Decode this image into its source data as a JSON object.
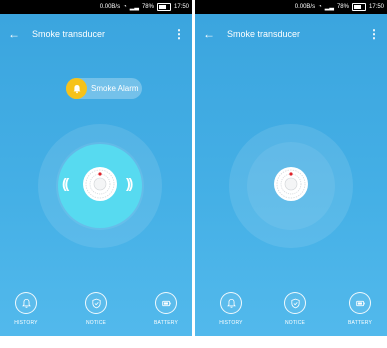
{
  "screens": [
    {
      "status": {
        "speed": "0.00B/s",
        "battery": "78%",
        "time": "17:50"
      },
      "title": "Smoke transducer",
      "alarm": {
        "label": "Smoke Alarm"
      },
      "nav": [
        {
          "label": "HISTORY",
          "icon": "bell-outline-icon"
        },
        {
          "label": "NOTICE",
          "icon": "shield-icon"
        },
        {
          "label": "BATTERY",
          "icon": "battery-icon"
        }
      ]
    },
    {
      "status": {
        "speed": "0.00B/s",
        "battery": "78%",
        "time": "17:50"
      },
      "title": "Smoke transducer",
      "nav": [
        {
          "label": "HISTORY",
          "icon": "bell-outline-icon"
        },
        {
          "label": "NOTICE",
          "icon": "shield-icon"
        },
        {
          "label": "BATTERY",
          "icon": "battery-icon"
        }
      ]
    }
  ],
  "colors": {
    "background": "#3aa4de",
    "alarm_bell": "#f6c21a",
    "active_core": "#57daf0",
    "indicator": "#e0222a"
  }
}
